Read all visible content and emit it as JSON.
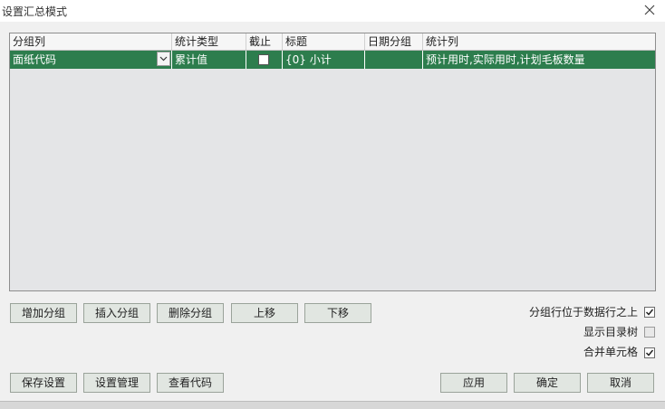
{
  "window": {
    "title": "设置汇总模式"
  },
  "grid": {
    "columns": [
      "分组列",
      "统计类型",
      "截止",
      "标题",
      "日期分组",
      "统计列"
    ],
    "rows": [
      {
        "group_column": "面纸代码",
        "stat_type": "累计值",
        "cutoff_checked": false,
        "title": "{0} 小计",
        "date_group": "",
        "stat_columns": "预计用时,实际用时,计划毛板数量"
      }
    ]
  },
  "buttons": {
    "add_group": "增加分组",
    "insert_group": "插入分组",
    "delete_group": "删除分组",
    "move_up": "上移",
    "move_down": "下移",
    "save_settings": "保存设置",
    "manage_settings": "设置管理",
    "view_code": "查看代码",
    "apply": "应用",
    "ok": "确定",
    "cancel": "取消"
  },
  "options": {
    "group_row_above": {
      "label": "分组行位于数据行之上",
      "checked": true
    },
    "show_tree": {
      "label": "显示目录树",
      "checked": false
    },
    "merge_cells": {
      "label": "合并单元格",
      "checked": true
    }
  },
  "colors": {
    "selected_row": "#2d7d4d",
    "grid_bg": "#e4e5e7",
    "button_bg": "#e1e6e1"
  }
}
